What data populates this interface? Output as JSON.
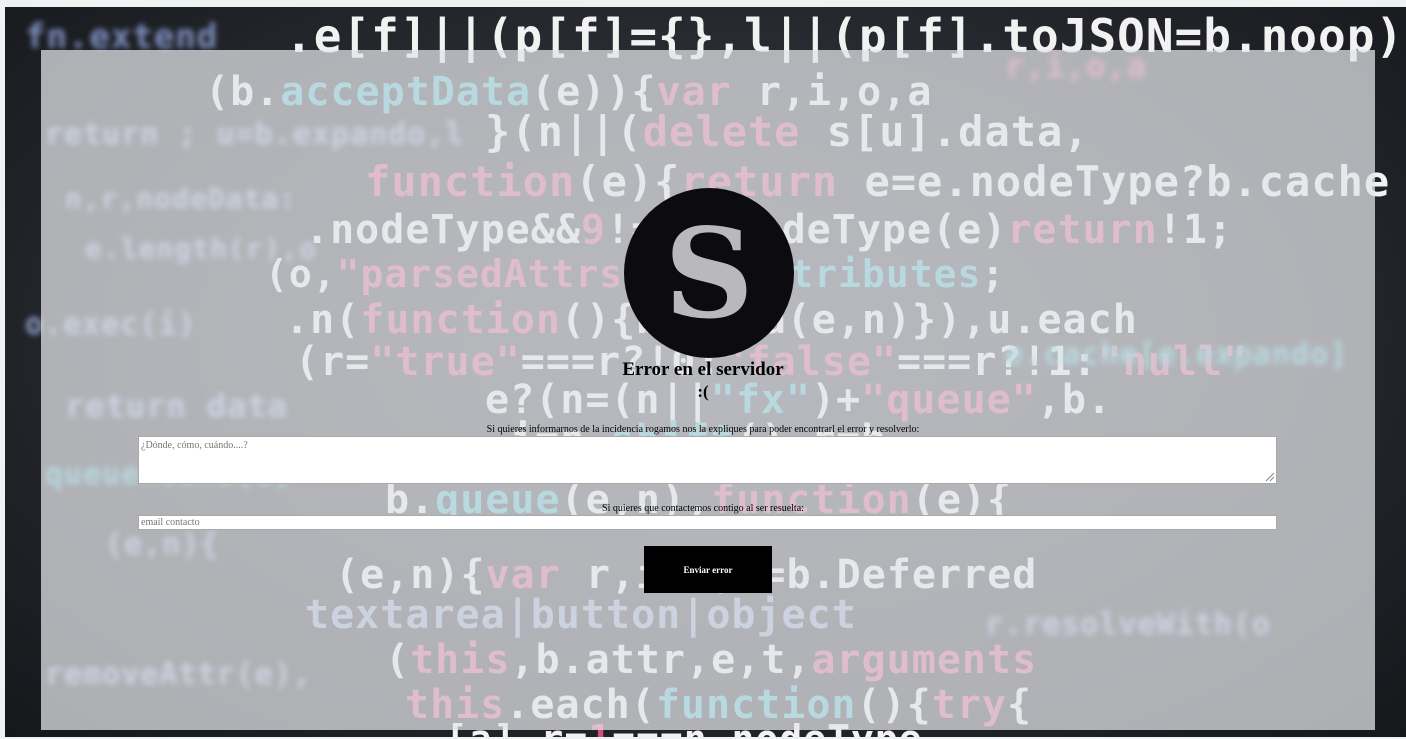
{
  "logo": {
    "letter": "S"
  },
  "error": {
    "title": "Error en el servidor",
    "face": ":("
  },
  "report": {
    "description_label": "Si quieres informarnos de la incidencia rogamos nos la expliques para poder encontrarl el error y resolverlo:",
    "description_value": "",
    "description_placeholder": "¿Dónde, cómo, cuándo....?",
    "contact_label": "Si quieres que contactemos contigo al ser resuelta:",
    "contact_value": "",
    "contact_placeholder": "email contacto",
    "submit_label": "Enviar error"
  },
  "colors": {
    "overlay": "#e2e4e8",
    "logo_background": "#0c0c0e",
    "logo_letter": "#b9b9bd",
    "button_background": "#000000",
    "button_text": "#ffffff"
  }
}
